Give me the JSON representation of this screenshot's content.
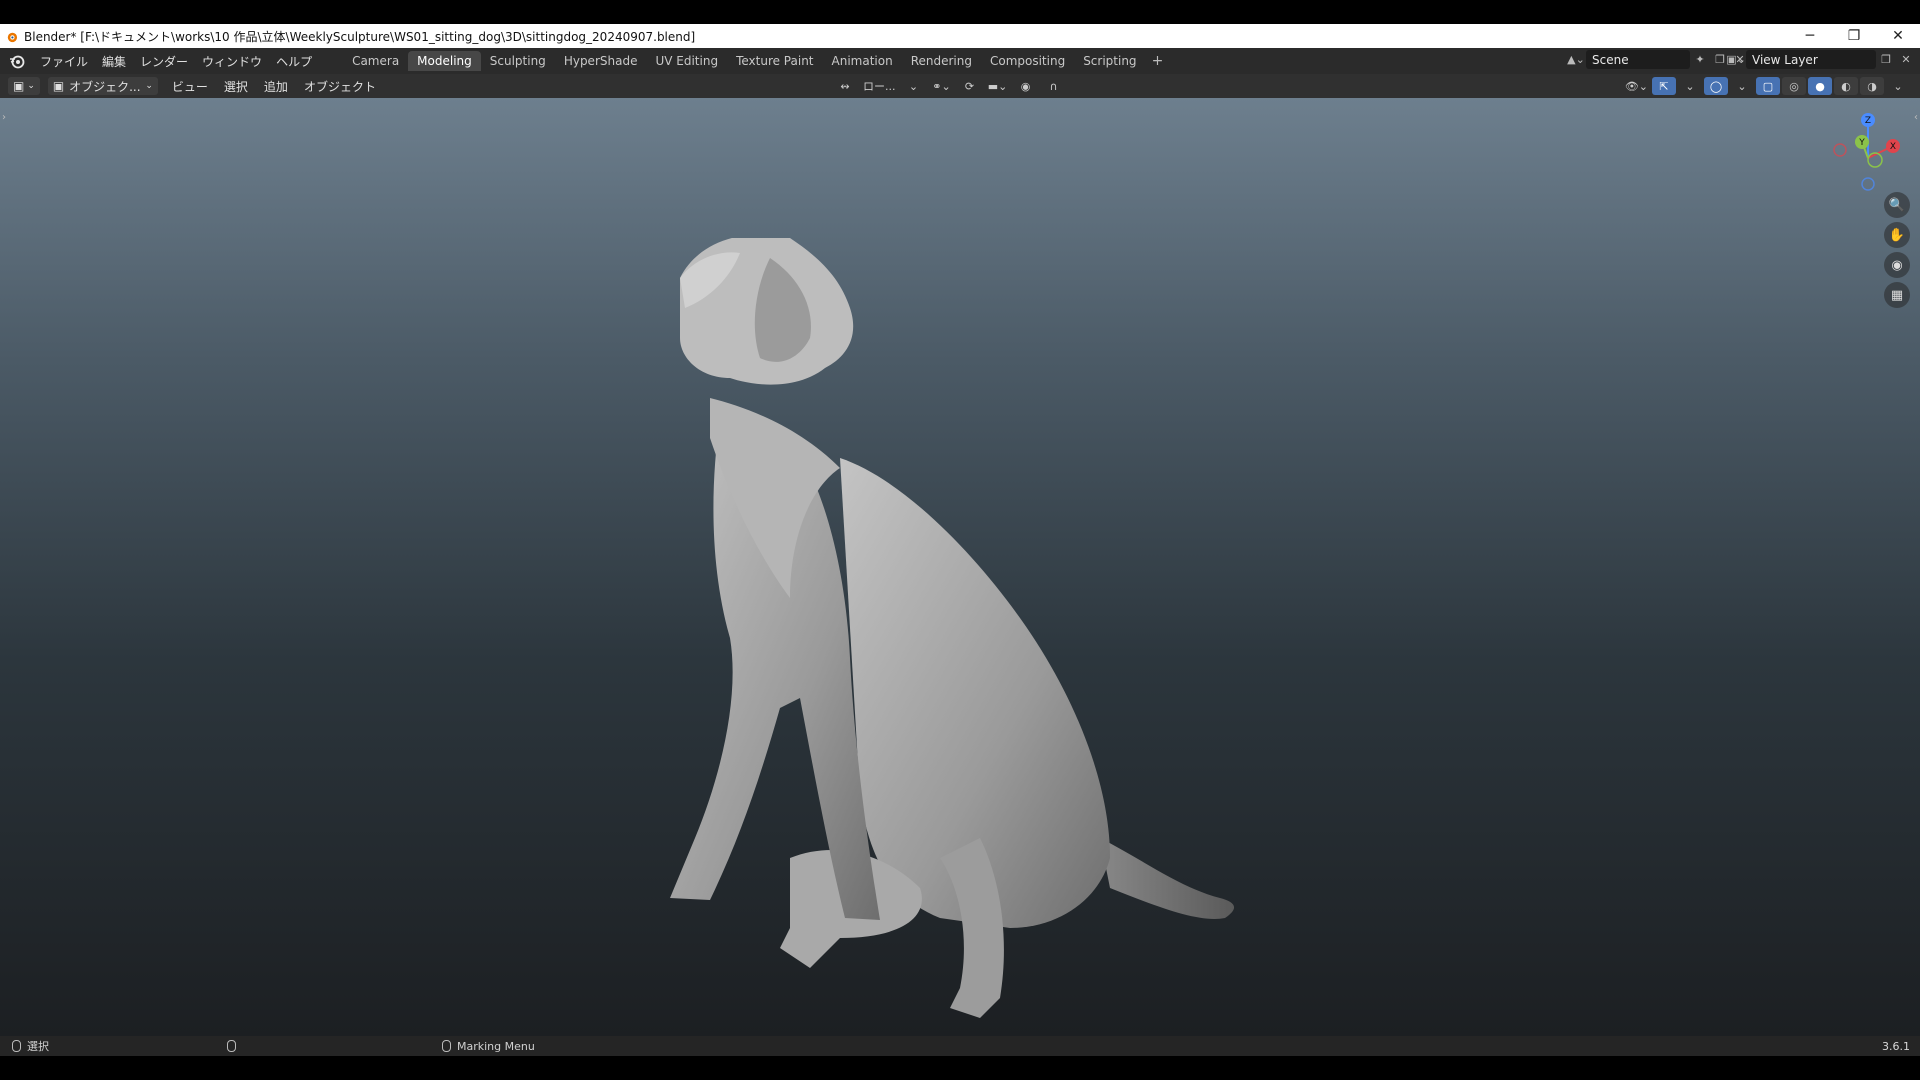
{
  "window": {
    "title": "Blender* [F:\\ドキュメント\\works\\10 作品\\立体\\WeeklySculpture\\WS01_sitting_dog\\3D\\sittingdog_20240907.blend]",
    "minimize": "─",
    "restore": "❐",
    "close": "✕"
  },
  "menubar": {
    "menus": [
      "ファイル",
      "編集",
      "レンダー",
      "ウィンドウ",
      "ヘルプ"
    ],
    "workspaces": [
      "Camera",
      "Modeling",
      "Sculpting",
      "HyperShade",
      "UV Editing",
      "Texture Paint",
      "Animation",
      "Rendering",
      "Compositing",
      "Scripting"
    ],
    "active_workspace": "Modeling",
    "add_workspace": "+",
    "scene": "Scene",
    "view_layer": "View Layer"
  },
  "header3d": {
    "mode": "オブジェク...",
    "menus": [
      "ビュー",
      "選択",
      "追加",
      "オブジェクト"
    ],
    "transform_orientation": "ロー..."
  },
  "gizmo": {
    "z": "Z",
    "y": "Y",
    "x": "X"
  },
  "statusbar": {
    "select_hint": "選択",
    "marking_menu": "Marking Menu",
    "version": "3.6.1"
  },
  "colors": {
    "accent": "#4772b3",
    "axis_x": "#e0444c",
    "axis_y": "#8bc34a",
    "axis_z": "#4a8cff"
  }
}
